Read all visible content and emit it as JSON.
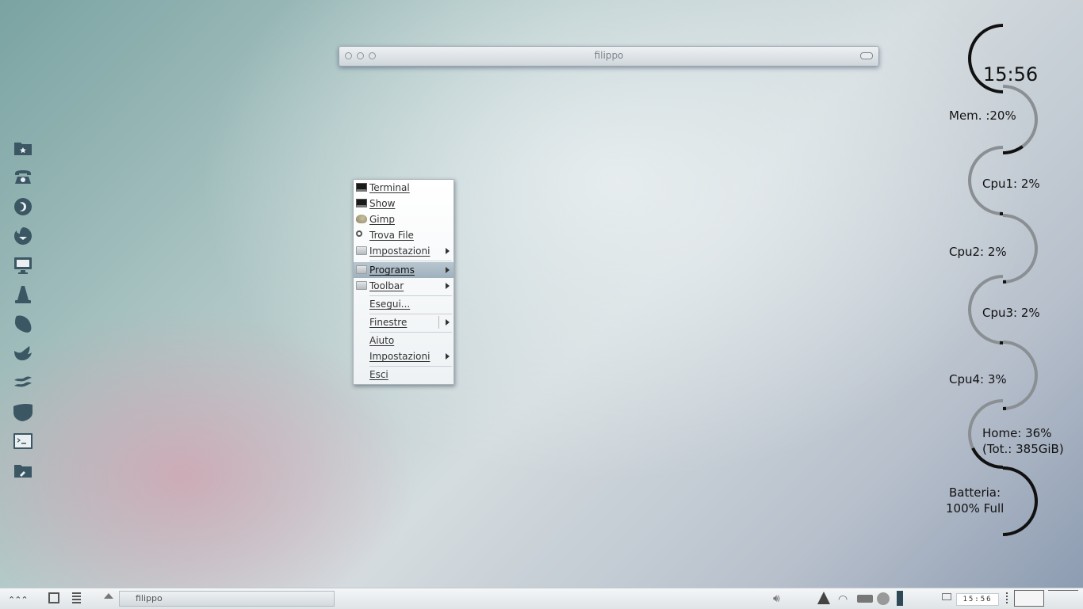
{
  "window": {
    "title": "filippo"
  },
  "dock": {
    "items": [
      {
        "name": "home-folder-icon"
      },
      {
        "name": "phone-icon"
      },
      {
        "name": "firefox-icon"
      },
      {
        "name": "thunderbird-icon"
      },
      {
        "name": "monitor-icon"
      },
      {
        "name": "vlc-icon"
      },
      {
        "name": "pidgin-icon"
      },
      {
        "name": "gimp-icon"
      },
      {
        "name": "libreoffice-icon"
      },
      {
        "name": "shield-icon"
      },
      {
        "name": "terminal-icon"
      },
      {
        "name": "settings-folder-icon"
      }
    ]
  },
  "menu": {
    "items": {
      "terminal": "Terminal",
      "show": "Show",
      "gimp": "Gimp",
      "trova_file": "Trova File",
      "impostazioni": "Impostazioni",
      "programs": "Programs",
      "toolbar": "Toolbar",
      "esegui": "Esegui...",
      "finestre": "Finestre",
      "aiuto": "Aiuto",
      "impostazioni2": "Impostazioni",
      "esci": "Esci"
    }
  },
  "conky": {
    "clock": "15:56",
    "mem": "Mem. :20%",
    "cpu1": "Cpu1: 2%",
    "cpu2": "Cpu2: 2%",
    "cpu3": "Cpu3: 2%",
    "cpu4": "Cpu4: 3%",
    "home": "Home: 36%",
    "home_total": "(Tot.: 385GiB)",
    "battery": "Batteria:",
    "battery_status": "100% Full",
    "levels": {
      "mem": 0.2,
      "cpu1": 0.02,
      "cpu2": 0.02,
      "cpu3": 0.02,
      "cpu4": 0.03,
      "home": 0.36,
      "battery": 1.0
    }
  },
  "panel": {
    "task_title": "filippo",
    "clock": "15:56"
  },
  "colors": {
    "accent": "#3b5763",
    "menu_selected": "#a9b9c4",
    "arc_track": "#8a8f93",
    "arc_fill": "#111111"
  }
}
